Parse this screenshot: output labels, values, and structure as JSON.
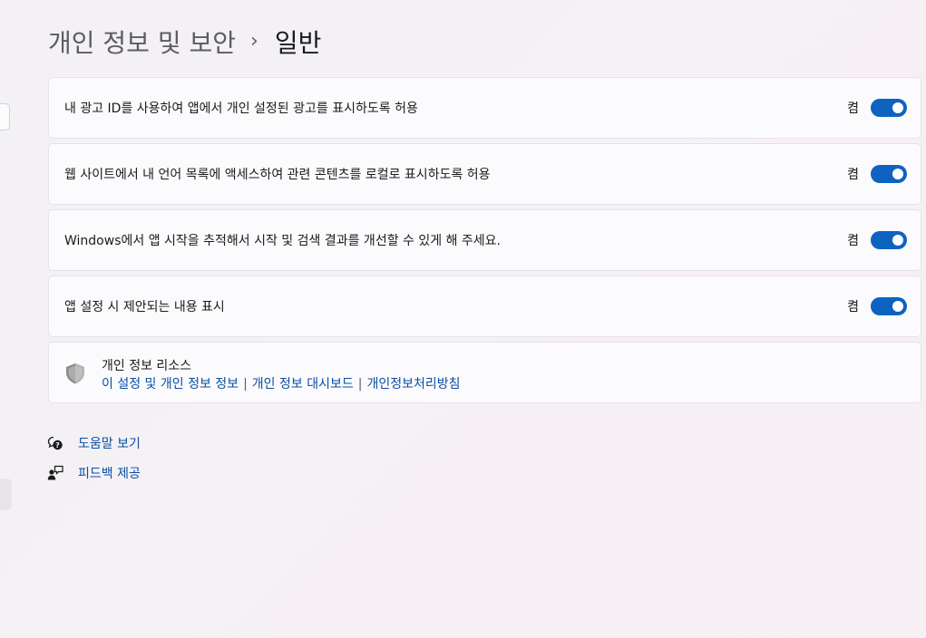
{
  "breadcrumb": {
    "parent": "개인 정보 및 보안",
    "separator": "›",
    "current": "일반"
  },
  "settings": [
    {
      "label": "내 광고 ID를 사용하여 앱에서 개인 설정된 광고를 표시하도록 허용",
      "state_text": "켬",
      "on": true
    },
    {
      "label": "웹 사이트에서 내 언어 목록에 액세스하여 관련 콘텐츠를 로컬로 표시하도록 허용",
      "state_text": "켬",
      "on": true
    },
    {
      "label": "Windows에서 앱 시작을 추적해서 시작 및 검색 결과를 개선할 수 있게 해 주세요.",
      "state_text": "켬",
      "on": true
    },
    {
      "label": "앱 설정 시 제안되는 내용 표시",
      "state_text": "켬",
      "on": true
    }
  ],
  "resources": {
    "icon": "shield-icon",
    "title": "개인 정보 리소스",
    "links": [
      "이 설정 및 개인 정보 정보",
      "개인 정보 대시보드",
      "개인정보처리방침"
    ],
    "link_separator": "|"
  },
  "help": {
    "get_help": {
      "icon": "help-chat-icon",
      "label": "도움말 보기"
    },
    "feedback": {
      "icon": "feedback-icon",
      "label": "피드백 제공"
    }
  },
  "colors": {
    "accent": "#0e63c0",
    "link": "#0b4fa2"
  }
}
